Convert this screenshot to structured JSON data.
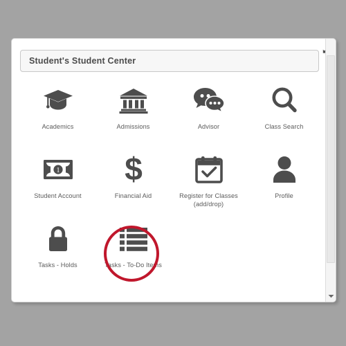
{
  "window": {
    "background_color": "#a3a3a3",
    "panel_background": "#ffffff"
  },
  "header": {
    "title": "Student's Student Center",
    "expand_icon": "expand-arrows-icon"
  },
  "scrollbar": {
    "down_arrow_icon": "chevron-down-icon"
  },
  "colors": {
    "icon": "#4d4d4d",
    "label": "#5a5a5a",
    "annotation": "#c0172c",
    "header_text": "#4b4b4b"
  },
  "annotation": {
    "shape": "circle",
    "target": "Tasks - To-Do Items",
    "color": "#c0172c"
  },
  "tiles": [
    {
      "label": "Academics",
      "icon": "graduation-cap-icon"
    },
    {
      "label": "Admissions",
      "icon": "bank-building-icon"
    },
    {
      "label": "Advisor",
      "icon": "speech-bubbles-icon"
    },
    {
      "label": "Class Search",
      "icon": "magnifying-glass-icon"
    },
    {
      "label": "Student Account",
      "icon": "banknote-icon"
    },
    {
      "label": "Financial Aid",
      "icon": "dollar-sign-icon"
    },
    {
      "label": "Register for Classes\n(add/drop)",
      "icon": "calendar-check-icon"
    },
    {
      "label": "Profile",
      "icon": "person-icon"
    },
    {
      "label": "Tasks - Holds",
      "icon": "padlock-icon"
    },
    {
      "label": "Tasks - To-Do Items",
      "icon": "list-icon"
    }
  ]
}
